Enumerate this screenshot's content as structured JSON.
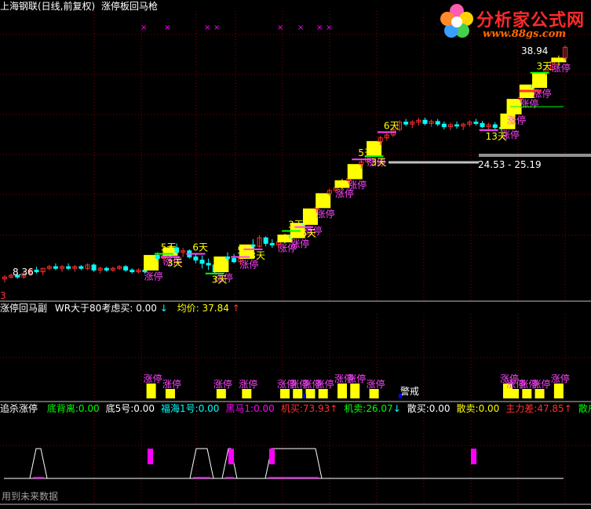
{
  "colors": {
    "background": "#000000",
    "grid": "#8b0000",
    "bull": "#ff3030",
    "bear": "#00ffff",
    "limit_up": "#ffff00",
    "zt_label": "#ff44ff",
    "day_label": "#ffff00",
    "green": "#00ff00",
    "white": "#ffffff",
    "panel_line": "#ffffff",
    "magenta_bar": "#ff00ff"
  },
  "panel1": {
    "title": "上海钢联(日线,前复权)",
    "indicator": "涨停板回马枪",
    "price_high_label": "38.94",
    "price_low_label": "8.36",
    "range_label": "24.53 - 25.19",
    "bottom_marker": "3",
    "zt_label": "涨停",
    "day_labels": [
      "5天",
      "3天",
      "6天",
      "3天",
      "5天",
      "3天",
      "3天",
      "6天",
      "5天",
      "3天",
      "6天",
      "13天",
      "3天"
    ],
    "x_marks": [
      "×",
      "×",
      "×",
      "×",
      "×",
      "×",
      "×",
      "×"
    ]
  },
  "panel2": {
    "title": "涨停回马副",
    "wr_label": "WR大于80考虑买:",
    "wr_value": "0.00",
    "wr_arrow": "↓",
    "avg_label": "均价:",
    "avg_value": "37.84",
    "avg_arrow": "↑",
    "warning": "警戒",
    "zt_label": "涨停"
  },
  "panel3": {
    "title": "追杀涨停",
    "fields": [
      {
        "label": "底背离:",
        "value": "0.00",
        "color": "#00ff00",
        "arrow": ""
      },
      {
        "label": "底5号:",
        "value": "0.00",
        "color": "#ffffff",
        "arrow": ""
      },
      {
        "label": "福海1号:",
        "value": "0.00",
        "color": "#00ffff",
        "arrow": ""
      },
      {
        "label": "黑马1:",
        "value": "0.00",
        "color": "#ff00ff",
        "arrow": ""
      },
      {
        "label": "机买:",
        "value": "73.93",
        "color": "#ff3030",
        "arrow": "↑"
      },
      {
        "label": "机卖:",
        "value": "26.07",
        "color": "#00ff00",
        "arrow": "↓"
      },
      {
        "label": "散买:",
        "value": "0.00",
        "color": "#ffffff",
        "arrow": ""
      },
      {
        "label": "散卖:",
        "value": "0.00",
        "color": "#ffff00",
        "arrow": ""
      },
      {
        "label": "主力差:",
        "value": "47.85",
        "color": "#ff3030",
        "arrow": "↑"
      },
      {
        "label": "散户差",
        "value": "",
        "color": "#00ff00",
        "arrow": ""
      }
    ],
    "footer": "用到未来数据"
  },
  "logo": {
    "text": "分析家公式网",
    "url": "www.88gs.com"
  },
  "chart_data": {
    "type": "candlestick",
    "candles": [
      [
        8.4,
        8.6,
        8.2,
        8.5
      ],
      [
        8.5,
        8.7,
        8.4,
        8.6
      ],
      [
        8.6,
        8.7,
        8.4,
        8.5
      ],
      [
        8.5,
        8.8,
        8.4,
        8.7
      ],
      [
        8.7,
        9.0,
        8.6,
        8.9
      ],
      [
        8.9,
        9.1,
        8.7,
        8.8
      ],
      [
        8.8,
        9.0,
        8.6,
        9.0
      ],
      [
        9.0,
        9.2,
        8.9,
        9.1
      ],
      [
        9.1,
        9.3,
        8.9,
        9.0
      ],
      [
        9.0,
        9.2,
        8.8,
        9.1
      ],
      [
        9.1,
        9.3,
        8.9,
        9.0
      ],
      [
        9.0,
        9.2,
        8.8,
        9.1
      ],
      [
        9.1,
        9.2,
        8.9,
        9.0
      ],
      [
        9.0,
        9.3,
        8.9,
        9.2
      ],
      [
        9.2,
        9.3,
        8.8,
        8.9
      ],
      [
        8.9,
        9.1,
        8.7,
        9.0
      ],
      [
        9.0,
        9.1,
        8.8,
        8.9
      ],
      [
        8.9,
        9.1,
        8.8,
        9.0
      ],
      [
        9.0,
        9.2,
        8.9,
        9.1
      ],
      [
        9.1,
        9.2,
        8.8,
        8.9
      ],
      [
        8.9,
        9.0,
        8.7,
        8.8
      ],
      [
        8.8,
        9.0,
        8.7,
        8.9
      ],
      [
        8.9,
        9.0,
        8.7,
        8.8
      ],
      [
        8.9,
        9.8,
        8.9,
        9.8
      ],
      [
        9.8,
        10.0,
        9.4,
        9.6
      ],
      [
        9.6,
        9.9,
        9.3,
        9.8
      ],
      [
        9.8,
        10.5,
        9.7,
        10.3
      ],
      [
        10.3,
        10.6,
        9.9,
        10.0
      ],
      [
        10.0,
        10.3,
        9.7,
        10.1
      ],
      [
        10.1,
        10.2,
        9.6,
        9.7
      ],
      [
        9.7,
        9.9,
        9.3,
        9.5
      ],
      [
        9.5,
        9.8,
        9.0,
        9.3
      ],
      [
        9.3,
        9.6,
        8.9,
        9.2
      ],
      [
        9.2,
        9.4,
        8.7,
        8.8
      ],
      [
        8.8,
        9.7,
        8.8,
        9.7
      ],
      [
        9.7,
        10.0,
        9.4,
        9.6
      ],
      [
        9.6,
        9.9,
        9.3,
        9.4
      ],
      [
        9.4,
        9.7,
        9.2,
        9.6
      ],
      [
        9.6,
        10.5,
        9.6,
        10.5
      ],
      [
        10.5,
        10.9,
        10.2,
        10.4
      ],
      [
        10.4,
        11.2,
        10.3,
        11.0
      ],
      [
        11.0,
        11.1,
        10.4,
        10.6
      ],
      [
        10.6,
        10.9,
        10.3,
        10.5
      ],
      [
        10.5,
        10.8,
        10.2,
        10.7
      ],
      [
        10.7,
        11.3,
        10.6,
        11.2
      ],
      [
        11.2,
        11.5,
        10.9,
        11.0
      ],
      [
        11.0,
        12.1,
        11.0,
        12.1
      ],
      [
        12.1,
        12.3,
        11.8,
        12.0
      ],
      [
        12.0,
        13.3,
        12.0,
        13.3
      ],
      [
        13.3,
        13.6,
        13.0,
        13.4
      ],
      [
        13.4,
        14.7,
        13.4,
        14.7
      ],
      [
        14.7,
        15.2,
        14.5,
        15.0
      ],
      [
        15.0,
        15.5,
        14.8,
        15.3
      ],
      [
        15.3,
        16.2,
        15.1,
        16.0
      ],
      [
        16.0,
        16.5,
        15.7,
        16.2
      ],
      [
        16.2,
        17.8,
        16.2,
        17.8
      ],
      [
        17.8,
        18.4,
        17.3,
        18.1
      ],
      [
        18.1,
        19.0,
        17.9,
        18.8
      ],
      [
        18.8,
        20.7,
        18.8,
        20.7
      ],
      [
        20.7,
        21.5,
        20.2,
        21.2
      ],
      [
        21.2,
        22.0,
        20.8,
        21.6
      ],
      [
        21.6,
        22.8,
        21.3,
        22.4
      ],
      [
        22.4,
        23.8,
        22.1,
        23.5
      ],
      [
        23.5,
        24.0,
        22.9,
        23.2
      ],
      [
        23.2,
        23.8,
        22.6,
        23.5
      ],
      [
        23.5,
        24.2,
        23.0,
        23.8
      ],
      [
        23.8,
        24.2,
        23.0,
        23.3
      ],
      [
        23.3,
        23.9,
        22.8,
        23.6
      ],
      [
        23.6,
        24.0,
        22.9,
        23.2
      ],
      [
        23.2,
        23.6,
        22.4,
        22.8
      ],
      [
        22.8,
        23.4,
        22.3,
        23.1
      ],
      [
        23.1,
        23.6,
        22.5,
        22.9
      ],
      [
        22.9,
        23.4,
        22.3,
        23.2
      ],
      [
        23.2,
        23.8,
        22.8,
        23.5
      ],
      [
        23.5,
        24.0,
        23.0,
        23.3
      ],
      [
        23.3,
        23.7,
        22.6,
        22.8
      ],
      [
        22.8,
        23.4,
        22.3,
        23.1
      ],
      [
        23.1,
        23.5,
        22.4,
        22.7
      ],
      [
        22.7,
        23.2,
        22.1,
        22.5
      ],
      [
        22.5,
        24.8,
        22.5,
        24.8
      ],
      [
        24.8,
        27.3,
        24.8,
        27.3
      ],
      [
        27.3,
        28.0,
        26.8,
        27.6
      ],
      [
        27.6,
        30.0,
        27.6,
        30.0
      ],
      [
        30.0,
        30.4,
        29.2,
        29.5
      ],
      [
        29.5,
        32.5,
        29.5,
        32.5
      ],
      [
        32.5,
        33.9,
        32.0,
        33.2
      ],
      [
        33.2,
        35.2,
        33.0,
        34.9
      ],
      [
        34.9,
        36.4,
        34.1,
        35.8
      ],
      [
        35.8,
        38.94,
        35.2,
        38.4
      ]
    ],
    "limit_up_days": [
      23,
      26,
      34,
      38,
      44,
      46,
      48,
      50,
      53,
      55,
      58,
      79,
      80,
      82,
      84,
      87
    ]
  }
}
